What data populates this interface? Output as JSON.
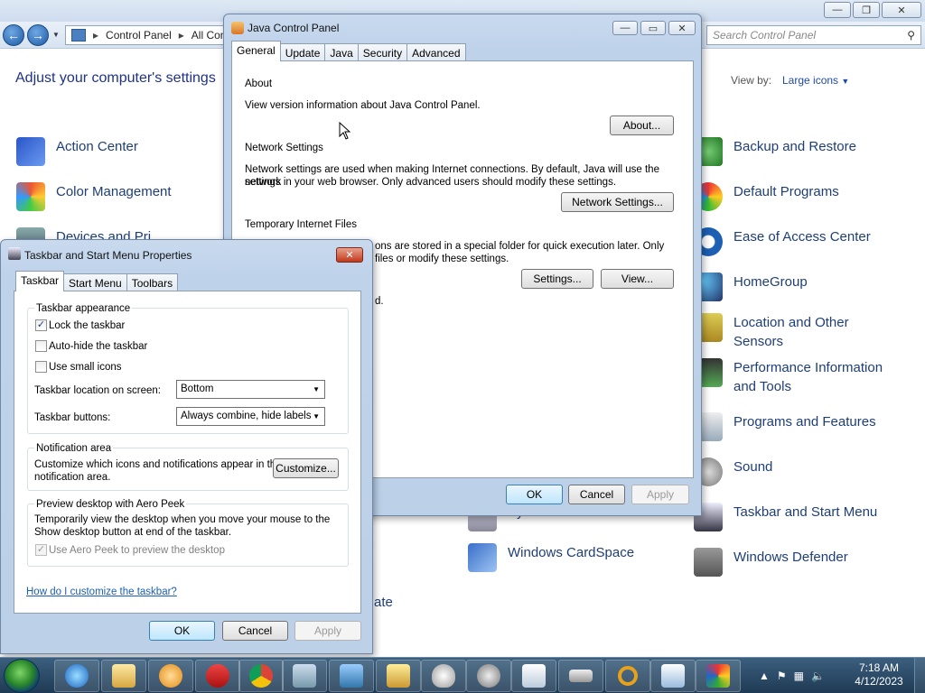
{
  "control_panel": {
    "address": [
      "Control Panel",
      "All Con"
    ],
    "search_placeholder": "Search Control Panel",
    "heading": "Adjust your computer's settings",
    "view_by_label": "View by:",
    "view_by_value": "Large icons",
    "items_left": [
      {
        "label": "Action Center",
        "icon": "flag-icon"
      },
      {
        "label": "Color Management",
        "icon": "color-management-icon"
      },
      {
        "label": "Devices and Pri",
        "icon": "devices-icon"
      },
      {
        "label": "System",
        "icon": "system-icon"
      },
      {
        "label": "Windows CardSpace",
        "icon": "cardspace-icon"
      },
      {
        "label": "ate",
        "icon": ""
      }
    ],
    "items_right": [
      {
        "label": "Backup and Restore",
        "icon": "backup-icon"
      },
      {
        "label": "Default Programs",
        "icon": "default-programs-icon"
      },
      {
        "label": "Ease of Access Center",
        "icon": "ease-of-access-icon"
      },
      {
        "label": "HomeGroup",
        "icon": "homegroup-icon"
      },
      {
        "label": "Location and Other Sensors",
        "icon": "location-icon"
      },
      {
        "label": "Performance Information and Tools",
        "icon": "performance-icon"
      },
      {
        "label": "Programs and Features",
        "icon": "programs-icon"
      },
      {
        "label": "Sound",
        "icon": "sound-icon"
      },
      {
        "label": "Taskbar and Start Menu",
        "icon": "taskbar-icon"
      },
      {
        "label": "Windows Defender",
        "icon": "defender-icon"
      }
    ]
  },
  "java": {
    "title": "Java Control Panel",
    "tabs": [
      "General",
      "Update",
      "Java",
      "Security",
      "Advanced"
    ],
    "about_heading": "About",
    "about_text": "View version information about Java Control Panel.",
    "about_button": "About...",
    "network_heading": "Network Settings",
    "network_text_1": "Network settings are used when making Internet connections. By default, Java will use the network",
    "network_text_2": "settings in your web browser. Only advanced users should modify these settings.",
    "network_button": "Network Settings...",
    "temp_heading": "Temporary Internet Files",
    "temp_text_1": "ons are stored in a special folder for quick execution later. Only",
    "temp_text_2": "files or modify these settings.",
    "temp_fragment": "d.",
    "settings_button": "Settings...",
    "view_button": "View...",
    "ok": "OK",
    "cancel": "Cancel",
    "apply": "Apply"
  },
  "taskbar_props": {
    "title": "Taskbar and Start Menu Properties",
    "tabs": [
      "Taskbar",
      "Start Menu",
      "Toolbars"
    ],
    "appearance_label": "Taskbar appearance",
    "lock_label": "Lock the taskbar",
    "lock_checked": true,
    "autohide_label": "Auto-hide the taskbar",
    "autohide_checked": false,
    "small_icons_label": "Use small icons",
    "small_icons_checked": false,
    "location_label": "Taskbar location on screen:",
    "location_value": "Bottom",
    "buttons_label": "Taskbar buttons:",
    "buttons_value": "Always combine, hide labels",
    "notification_label": "Notification area",
    "notification_text_1": "Customize which icons and notifications appear in the",
    "notification_text_2": "notification area.",
    "customize_button": "Customize...",
    "peek_label": "Preview desktop with Aero Peek",
    "peek_text_1": "Temporarily view the desktop when you move your mouse to the",
    "peek_text_2": "Show desktop button at end of the taskbar.",
    "peek_checkbox_label": "Use Aero Peek to preview the desktop",
    "peek_checked": true,
    "help_link": "How do I customize the taskbar?",
    "ok": "OK",
    "cancel": "Cancel",
    "apply": "Apply"
  },
  "taskbar": {
    "pinned": [
      "internet-explorer-icon",
      "file-explorer-icon",
      "media-player-icon",
      "ccleaner-icon",
      "chrome-icon",
      "document-icon",
      "control-panel-icon",
      "folder-icon",
      "mouse-icon",
      "sound-icon",
      "task-scheduler-icon",
      "keyboard-icon",
      "search-icon",
      "wordpad-icon",
      "avg-icon"
    ],
    "time": "7:18 AM",
    "date": "4/12/2023"
  }
}
